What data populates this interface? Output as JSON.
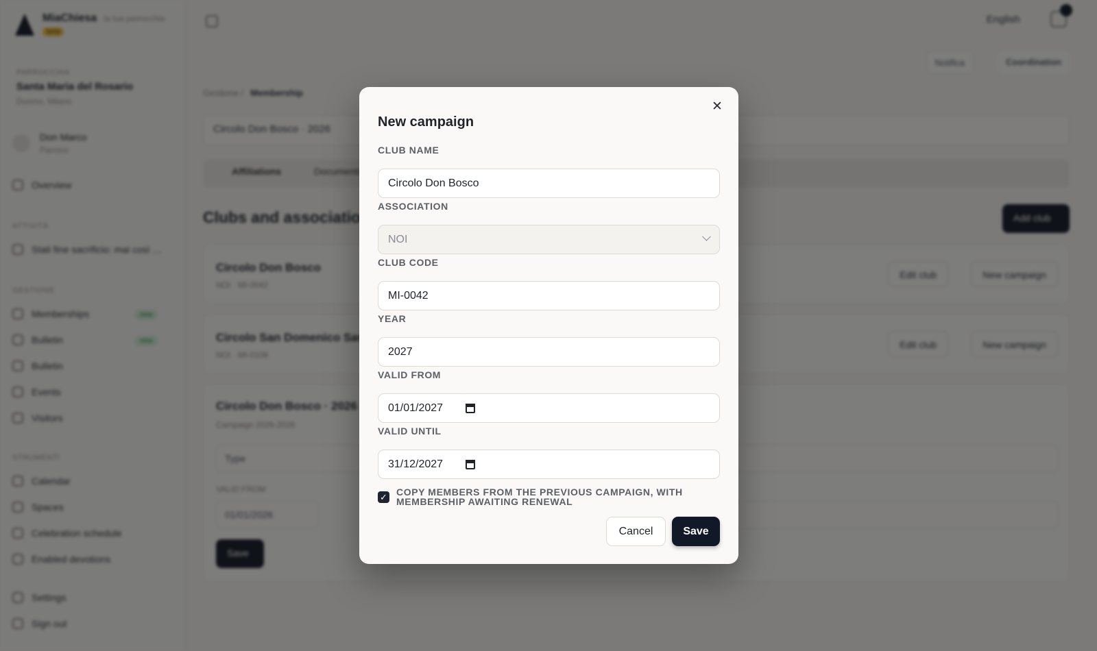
{
  "app": {
    "brand_name": "MiaChiesa",
    "brand_sub": "la tua parrocchia",
    "brand_badge": "beta"
  },
  "sidebar": {
    "parish_label": "Parrocchia",
    "parish_name": "Santa Maria del Rosario",
    "parish_location": "Duomo, Milano",
    "user_name": "Don Marco",
    "user_role": "Parroco",
    "overview": "Overview",
    "section_activities": "Attività",
    "activity_item": "Stati fine sacrificio: mai così …",
    "section_management": "Gestione",
    "items": [
      "Memberships",
      "Bulletin",
      "Bulletin",
      "Events",
      "Visitors"
    ],
    "new_badge": "new",
    "section_tools": "Strumenti",
    "tools": [
      "Calendar",
      "Spaces",
      "Celebration schedule",
      "Enabled devotions"
    ],
    "settings": "Settings",
    "signout": "Sign out"
  },
  "header": {
    "language": "English",
    "btn_notify": "Notifica",
    "btn_coordination": "Coordination",
    "breadcrumb_root": "Gestione",
    "breadcrumb_current": "Membership",
    "selector_value": "Circolo Don Bosco · 2026",
    "tab_1": "Affiliations",
    "tab_2": "Documents",
    "section_title": "Clubs and associations",
    "add_club": "Add club"
  },
  "cards": [
    {
      "title": "Circolo Don Bosco",
      "sub": "NOI · MI-0042",
      "edit": "Edit club",
      "campaign": "New campaign"
    },
    {
      "title": "Circolo San Domenico Savio",
      "sub": "NOI · MI-0108",
      "edit": "Edit club",
      "campaign": "New campaign"
    },
    {
      "title": "Circolo Don Bosco · 2026",
      "sub": "Campaign 2026-2026",
      "type_label": "Type",
      "valid_from_label": "VALID FROM",
      "valid_from_value": "01/01/2026",
      "save": "Save"
    }
  ],
  "modal": {
    "title": "New campaign",
    "close_icon": "close-icon",
    "club_name_label": "CLUB NAME",
    "club_name_value": "Circolo Don Bosco",
    "association_label": "ASSOCIATION",
    "association_value": "NOI",
    "club_code_label": "CLUB CODE",
    "club_code_value": "MI-0042",
    "year_label": "YEAR",
    "year_value": "2027",
    "valid_from_label": "VALID FROM",
    "valid_from_value": "01/01/2027",
    "valid_until_label": "VALID UNTIL",
    "valid_until_value": "31/12/2027",
    "copy_members_label": "COPY MEMBERS FROM THE PREVIOUS CAMPAIGN, WITH MEMBERSHIP AWAITING RENEWAL",
    "copy_members_checked": true,
    "cancel_label": "Cancel",
    "save_label": "Save"
  }
}
